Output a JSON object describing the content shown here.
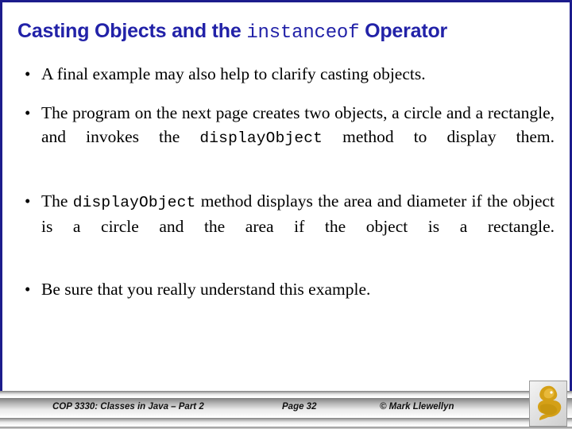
{
  "slide": {
    "title": {
      "before": "Casting Objects and the ",
      "mono": "instanceof",
      "after": " Operator",
      "color": "#2222a8"
    },
    "bullets": [
      {
        "marker": "•",
        "segments": [
          {
            "kind": "text",
            "value": "A final example may also help to clarify casting objects."
          }
        ]
      },
      {
        "marker": "•",
        "segments": [
          {
            "kind": "text",
            "value": "The program on the next page creates two objects, a circle and a rectangle, and invokes the "
          },
          {
            "kind": "code",
            "value": "displayObject"
          },
          {
            "kind": "text",
            "value": " method to display them."
          }
        ]
      },
      {
        "marker": "•",
        "segments": [
          {
            "kind": "text",
            "value": "The "
          },
          {
            "kind": "code",
            "value": "displayObject"
          },
          {
            "kind": "text",
            "value": " method displays the area and diameter if the object is a circle and the area if the object is a rectangle."
          }
        ]
      },
      {
        "marker": "•",
        "segments": [
          {
            "kind": "text",
            "value": "Be sure that you really understand this example."
          }
        ]
      }
    ],
    "footer": {
      "course": "COP 3330:  Classes in Java – Part 2",
      "page": "Page 32",
      "copyright": "© Mark Llewellyn",
      "logo_alt": "pegasus-logo",
      "logo_color": "#d4a017"
    }
  }
}
